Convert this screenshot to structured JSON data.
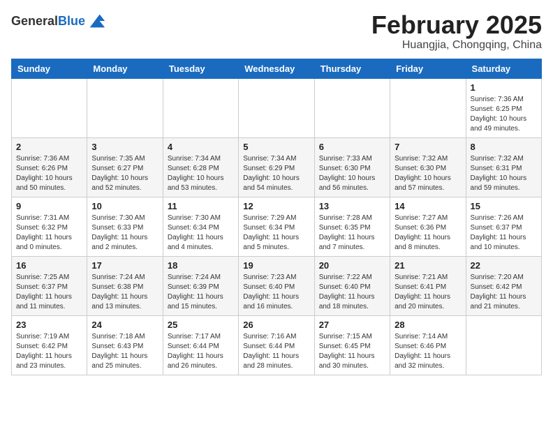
{
  "header": {
    "logo_general": "General",
    "logo_blue": "Blue",
    "main_title": "February 2025",
    "subtitle": "Huangjia, Chongqing, China"
  },
  "calendar": {
    "days_of_week": [
      "Sunday",
      "Monday",
      "Tuesday",
      "Wednesday",
      "Thursday",
      "Friday",
      "Saturday"
    ],
    "weeks": [
      [
        {
          "day": "",
          "info": ""
        },
        {
          "day": "",
          "info": ""
        },
        {
          "day": "",
          "info": ""
        },
        {
          "day": "",
          "info": ""
        },
        {
          "day": "",
          "info": ""
        },
        {
          "day": "",
          "info": ""
        },
        {
          "day": "1",
          "info": "Sunrise: 7:36 AM\nSunset: 6:25 PM\nDaylight: 10 hours\nand 49 minutes."
        }
      ],
      [
        {
          "day": "2",
          "info": "Sunrise: 7:36 AM\nSunset: 6:26 PM\nDaylight: 10 hours\nand 50 minutes."
        },
        {
          "day": "3",
          "info": "Sunrise: 7:35 AM\nSunset: 6:27 PM\nDaylight: 10 hours\nand 52 minutes."
        },
        {
          "day": "4",
          "info": "Sunrise: 7:34 AM\nSunset: 6:28 PM\nDaylight: 10 hours\nand 53 minutes."
        },
        {
          "day": "5",
          "info": "Sunrise: 7:34 AM\nSunset: 6:29 PM\nDaylight: 10 hours\nand 54 minutes."
        },
        {
          "day": "6",
          "info": "Sunrise: 7:33 AM\nSunset: 6:30 PM\nDaylight: 10 hours\nand 56 minutes."
        },
        {
          "day": "7",
          "info": "Sunrise: 7:32 AM\nSunset: 6:30 PM\nDaylight: 10 hours\nand 57 minutes."
        },
        {
          "day": "8",
          "info": "Sunrise: 7:32 AM\nSunset: 6:31 PM\nDaylight: 10 hours\nand 59 minutes."
        }
      ],
      [
        {
          "day": "9",
          "info": "Sunrise: 7:31 AM\nSunset: 6:32 PM\nDaylight: 11 hours\nand 0 minutes."
        },
        {
          "day": "10",
          "info": "Sunrise: 7:30 AM\nSunset: 6:33 PM\nDaylight: 11 hours\nand 2 minutes."
        },
        {
          "day": "11",
          "info": "Sunrise: 7:30 AM\nSunset: 6:34 PM\nDaylight: 11 hours\nand 4 minutes."
        },
        {
          "day": "12",
          "info": "Sunrise: 7:29 AM\nSunset: 6:34 PM\nDaylight: 11 hours\nand 5 minutes."
        },
        {
          "day": "13",
          "info": "Sunrise: 7:28 AM\nSunset: 6:35 PM\nDaylight: 11 hours\nand 7 minutes."
        },
        {
          "day": "14",
          "info": "Sunrise: 7:27 AM\nSunset: 6:36 PM\nDaylight: 11 hours\nand 8 minutes."
        },
        {
          "day": "15",
          "info": "Sunrise: 7:26 AM\nSunset: 6:37 PM\nDaylight: 11 hours\nand 10 minutes."
        }
      ],
      [
        {
          "day": "16",
          "info": "Sunrise: 7:25 AM\nSunset: 6:37 PM\nDaylight: 11 hours\nand 11 minutes."
        },
        {
          "day": "17",
          "info": "Sunrise: 7:24 AM\nSunset: 6:38 PM\nDaylight: 11 hours\nand 13 minutes."
        },
        {
          "day": "18",
          "info": "Sunrise: 7:24 AM\nSunset: 6:39 PM\nDaylight: 11 hours\nand 15 minutes."
        },
        {
          "day": "19",
          "info": "Sunrise: 7:23 AM\nSunset: 6:40 PM\nDaylight: 11 hours\nand 16 minutes."
        },
        {
          "day": "20",
          "info": "Sunrise: 7:22 AM\nSunset: 6:40 PM\nDaylight: 11 hours\nand 18 minutes."
        },
        {
          "day": "21",
          "info": "Sunrise: 7:21 AM\nSunset: 6:41 PM\nDaylight: 11 hours\nand 20 minutes."
        },
        {
          "day": "22",
          "info": "Sunrise: 7:20 AM\nSunset: 6:42 PM\nDaylight: 11 hours\nand 21 minutes."
        }
      ],
      [
        {
          "day": "23",
          "info": "Sunrise: 7:19 AM\nSunset: 6:42 PM\nDaylight: 11 hours\nand 23 minutes."
        },
        {
          "day": "24",
          "info": "Sunrise: 7:18 AM\nSunset: 6:43 PM\nDaylight: 11 hours\nand 25 minutes."
        },
        {
          "day": "25",
          "info": "Sunrise: 7:17 AM\nSunset: 6:44 PM\nDaylight: 11 hours\nand 26 minutes."
        },
        {
          "day": "26",
          "info": "Sunrise: 7:16 AM\nSunset: 6:44 PM\nDaylight: 11 hours\nand 28 minutes."
        },
        {
          "day": "27",
          "info": "Sunrise: 7:15 AM\nSunset: 6:45 PM\nDaylight: 11 hours\nand 30 minutes."
        },
        {
          "day": "28",
          "info": "Sunrise: 7:14 AM\nSunset: 6:46 PM\nDaylight: 11 hours\nand 32 minutes."
        },
        {
          "day": "",
          "info": ""
        }
      ]
    ]
  }
}
